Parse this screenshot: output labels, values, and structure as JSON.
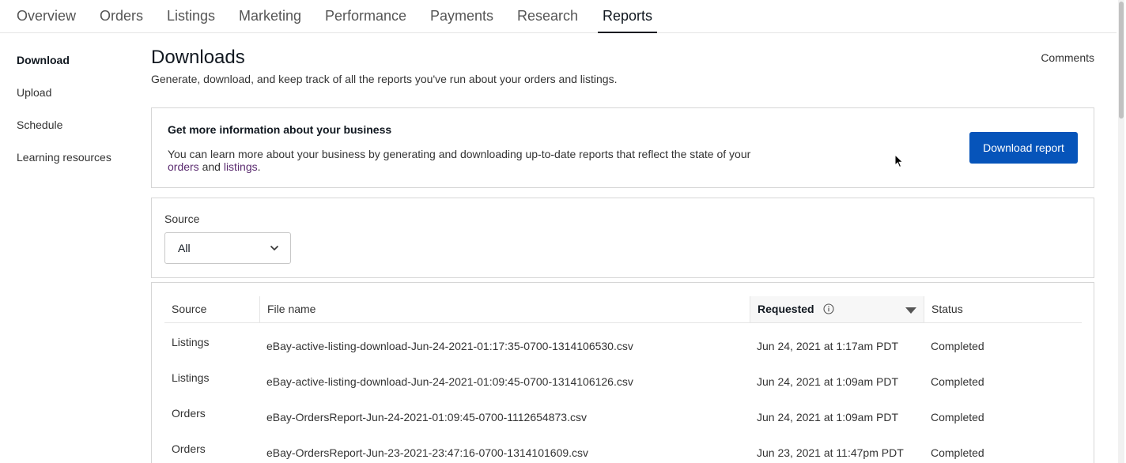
{
  "nav": {
    "tabs": [
      {
        "label": "Overview"
      },
      {
        "label": "Orders"
      },
      {
        "label": "Listings"
      },
      {
        "label": "Marketing"
      },
      {
        "label": "Performance"
      },
      {
        "label": "Payments"
      },
      {
        "label": "Research"
      },
      {
        "label": "Reports",
        "active": true
      }
    ]
  },
  "sidebar": {
    "items": [
      {
        "label": "Download",
        "active": true
      },
      {
        "label": "Upload"
      },
      {
        "label": "Schedule"
      },
      {
        "label": "Learning resources"
      }
    ]
  },
  "header": {
    "title": "Downloads",
    "subtitle": "Generate, download, and keep track of all the reports you've run about your orders and listings.",
    "comments": "Comments"
  },
  "info": {
    "title": "Get more information about your business",
    "body_prefix": "You can learn more about your business by generating and downloading up-to-date reports that reflect the state of your",
    "link_orders": "orders",
    "body_and": "and",
    "link_listings": "listings",
    "body_suffix": ".",
    "button": "Download report"
  },
  "filter": {
    "label": "Source",
    "value": "All"
  },
  "table": {
    "headers": {
      "source": "Source",
      "file": "File name",
      "requested": "Requested",
      "status": "Status"
    },
    "rows": [
      {
        "source": "Listings",
        "file": "eBay-active-listing-download-Jun-24-2021-01:17:35-0700-1314106530.csv",
        "requested": "Jun 24, 2021 at 1:17am PDT",
        "status": "Completed"
      },
      {
        "source": "Listings",
        "file": "eBay-active-listing-download-Jun-24-2021-01:09:45-0700-1314106126.csv",
        "requested": "Jun 24, 2021 at 1:09am PDT",
        "status": "Completed"
      },
      {
        "source": "Orders",
        "file": "eBay-OrdersReport-Jun-24-2021-01:09:45-0700-1112654873.csv",
        "requested": "Jun 24, 2021 at 1:09am PDT",
        "status": "Completed"
      },
      {
        "source": "Orders",
        "file": "eBay-OrdersReport-Jun-23-2021-23:47:16-0700-1314101609.csv",
        "requested": "Jun 23, 2021 at 11:47pm PDT",
        "status": "Completed"
      }
    ]
  },
  "colors": {
    "primary_button": "#0654ba",
    "link": "#5a2a6f"
  },
  "icons": {
    "select": "chevron-down-icon",
    "requested_info": "info-icon",
    "sort": "sort-desc-icon"
  }
}
